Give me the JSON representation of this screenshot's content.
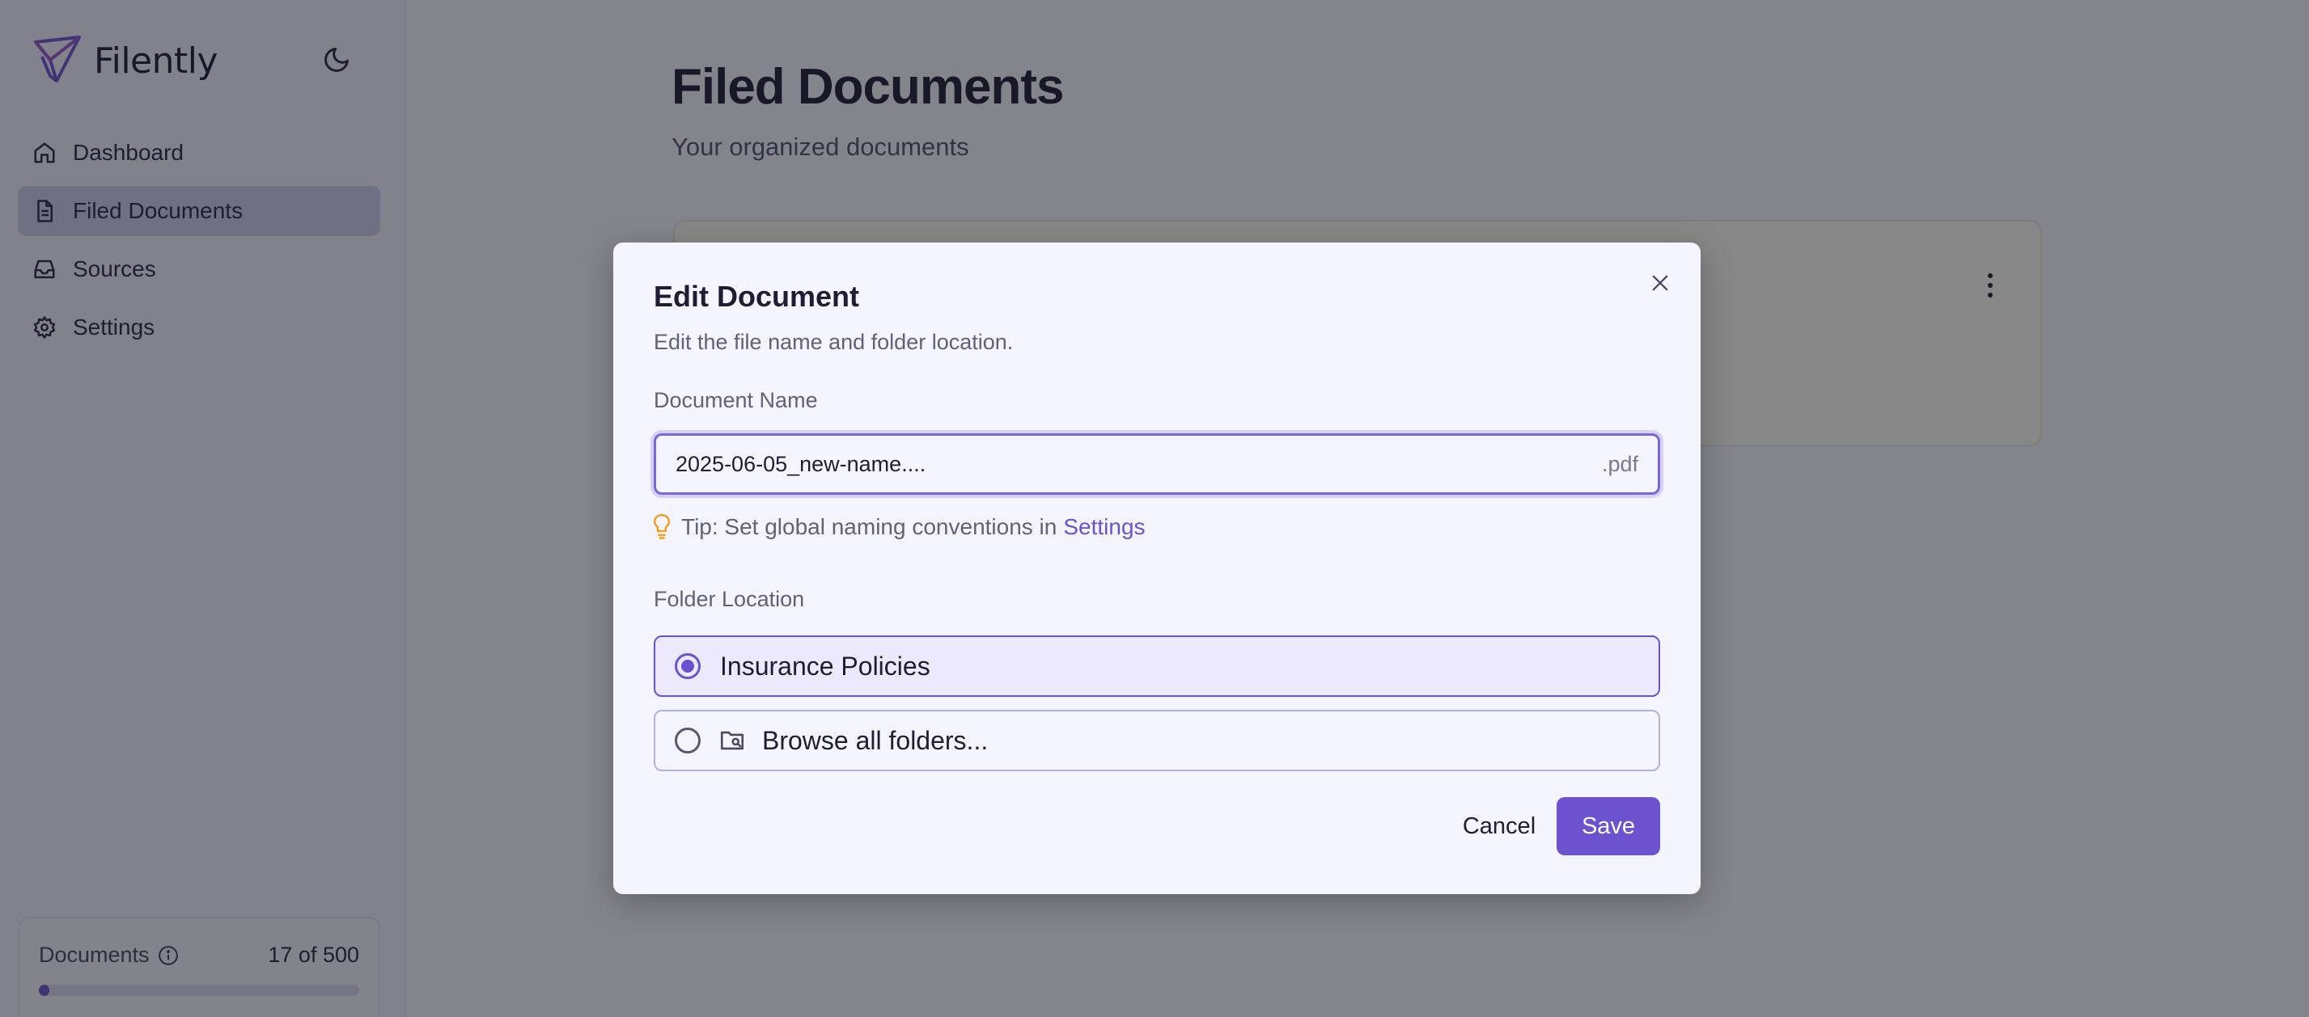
{
  "app": {
    "name": "Filently"
  },
  "sidebar": {
    "items": [
      {
        "label": "Dashboard",
        "icon": "home-icon"
      },
      {
        "label": "Filed Documents",
        "icon": "document-icon",
        "active": true
      },
      {
        "label": "Sources",
        "icon": "inbox-icon"
      },
      {
        "label": "Settings",
        "icon": "gear-icon"
      }
    ],
    "usage": {
      "label": "Documents",
      "count_text": "17 of 500",
      "used": 17,
      "limit": 500
    }
  },
  "main": {
    "title": "Filed Documents",
    "subtitle": "Your organized documents"
  },
  "dialog": {
    "title": "Edit Document",
    "description": "Edit the file name and folder location.",
    "name_label": "Document Name",
    "name_value": "2025-06-05_new-name....",
    "extension": ".pdf",
    "tip_text": "Tip: Set global naming conventions in",
    "tip_link": "Settings",
    "folder_label": "Folder Location",
    "folder_options": [
      {
        "label": "Insurance Policies",
        "selected": true
      },
      {
        "label": "Browse all folders...",
        "selected": false,
        "icon": "folder-search-icon"
      }
    ],
    "cancel_label": "Cancel",
    "save_label": "Save"
  },
  "colors": {
    "accent": "#6c52cf",
    "tip_icon": "#f0a020"
  }
}
